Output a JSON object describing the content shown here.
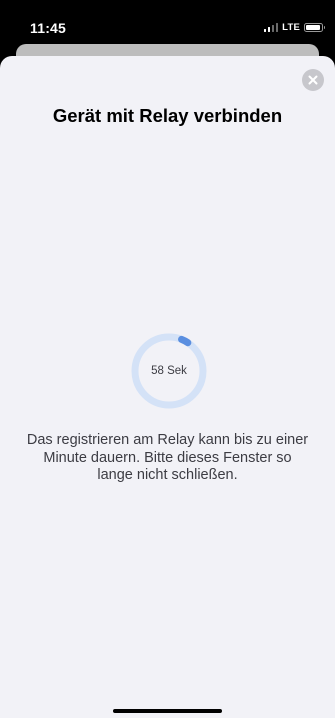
{
  "status_bar": {
    "time": "11:45",
    "network": "LTE",
    "signal_bars_active": 2,
    "signal_bars_total": 4,
    "battery_level": 0.9,
    "icons": [
      "signal-icon",
      "battery-icon"
    ]
  },
  "modal": {
    "title": "Gerät mit Relay verbinden",
    "close_icon": "close-icon",
    "progress": {
      "label": "58 Sek",
      "seconds_remaining": 58,
      "seconds_total": 60,
      "track_color": "#d4e2f7",
      "indicator_color": "#5b8fe0"
    },
    "message": "Das registrieren am Relay kann bis zu einer Minute dauern. Bitte dieses Fenster so lange nicht schließen."
  },
  "colors": {
    "sheet_background": "#f2f2f7",
    "close_button": "#c7c7cc"
  }
}
